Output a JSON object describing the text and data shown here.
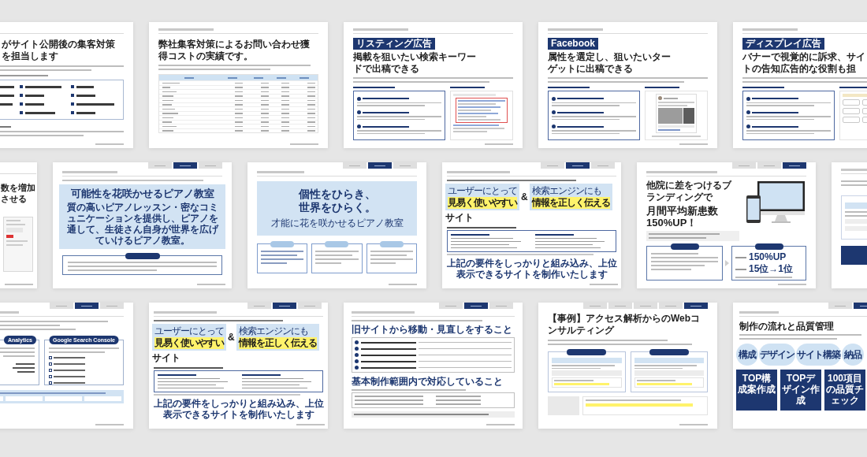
{
  "rows": [
    {
      "slides": [
        {
          "kind": "services",
          "title": "がサイト公開後の集客対策を担当します"
        },
        {
          "kind": "table",
          "title": "弊社集客対策によるお問い合わせ獲得コストの実績です。"
        },
        {
          "kind": "ad",
          "badge": "リスティング広告",
          "title": "掲載を狙いたい検索キーワードで出稿できる",
          "preview": {
            "kind": "search"
          }
        },
        {
          "kind": "ad",
          "badge": "Facebook",
          "title": "属性を選定し、狙いたいターゲットに出稿できる",
          "preview": {
            "kind": "post"
          }
        },
        {
          "kind": "ad",
          "badge": "ディスプレイ広告",
          "title": "バナーで視覚的に訴求、サイトの告知広告的な役割も担",
          "preview": {
            "kind": "banners"
          }
        }
      ]
    },
    {
      "slides": [
        {
          "kind": "partial",
          "title": "数を増加させる"
        },
        {
          "kind": "concept",
          "steps": [
            {
              "selected": false
            },
            {
              "selected": true
            },
            {
              "selected": false
            }
          ],
          "headline": "可能性を花咲かせるピアノ教室",
          "copy": "質の高いピアノレッスン・密なコミュニケーションを提供し、ピアノを通して、生徒さん自身が世界を広げていけるピアノ教室。"
        },
        {
          "kind": "catchcopy",
          "steps": [
            {
              "selected": false
            },
            {
              "selected": true
            },
            {
              "selected": false
            }
          ],
          "headline_lines": [
            "個性をひらき、",
            "世界をひらく。"
          ],
          "copy": "才能に花を咲かせるピアノ教室"
        },
        {
          "kind": "seo",
          "steps": [
            {
              "selected": false
            },
            {
              "selected": true
            },
            {
              "selected": false
            }
          ],
          "highlights": [
            {
              "lead": "ユーザーにとって",
              "emphasis": "見易く使いやすい"
            },
            {
              "lead": "検索エンジンにも",
              "emphasis": "情報を正しく伝える"
            }
          ],
          "joiner": "&",
          "suffix": "サイト",
          "conclusion": "上記の要件をしっかりと組み込み、上位表示できるサイトを制作いたします"
        },
        {
          "kind": "results",
          "steps": [
            {
              "selected": false
            },
            {
              "selected": false
            },
            {
              "selected": true
            }
          ],
          "lead": "他院に差をつけるブランディングで",
          "headline": "月間平均新患数150%UP！",
          "metrics": [
            "150%UP",
            "15位→1位"
          ]
        },
        {
          "kind": "support"
        }
      ]
    },
    {
      "slides": [
        {
          "kind": "consulting",
          "steps": [
            {
              "selected": false
            },
            {
              "selected": true
            },
            {
              "selected": false
            }
          ],
          "tools": [
            "Analytics",
            "Google Search Console"
          ]
        },
        {
          "kind": "seo",
          "steps": [
            {
              "selected": false
            },
            {
              "selected": true
            },
            {
              "selected": false
            }
          ],
          "highlights": [
            {
              "lead": "ユーザーにとって",
              "emphasis": "見易く使いやすい"
            },
            {
              "lead": "検索エンジンにも",
              "emphasis": "情報を正しく伝える"
            }
          ],
          "joiner": "&",
          "suffix": "サイト",
          "conclusion": "上記の要件をしっかりと組み込み、上位表示できるサイトを制作いたします"
        },
        {
          "kind": "renewal",
          "steps": [
            {
              "selected": false
            },
            {
              "selected": true
            },
            {
              "selected": false
            }
          ],
          "headings": [
            "旧サイトから移動・見直しをすること",
            "基本制作範囲内で対応していること"
          ]
        },
        {
          "kind": "case",
          "steps": [
            {
              "selected": false
            },
            {
              "selected": false
            },
            {
              "selected": false
            },
            {
              "selected": false
            },
            {
              "selected": true
            }
          ],
          "title": "【事例】アクセス解析からのWebコンサルティング"
        },
        {
          "kind": "flow",
          "steps": [
            {
              "selected": false
            },
            {
              "selected": true
            }
          ],
          "title": "制作の流れと品質管理",
          "phases": [
            "構成",
            "デザイン",
            "サイト構築",
            "納品"
          ],
          "tasks": [
            "TOP構成案作成",
            "TOPデザイン作成",
            "100項目の品質チェック"
          ]
        }
      ]
    }
  ]
}
